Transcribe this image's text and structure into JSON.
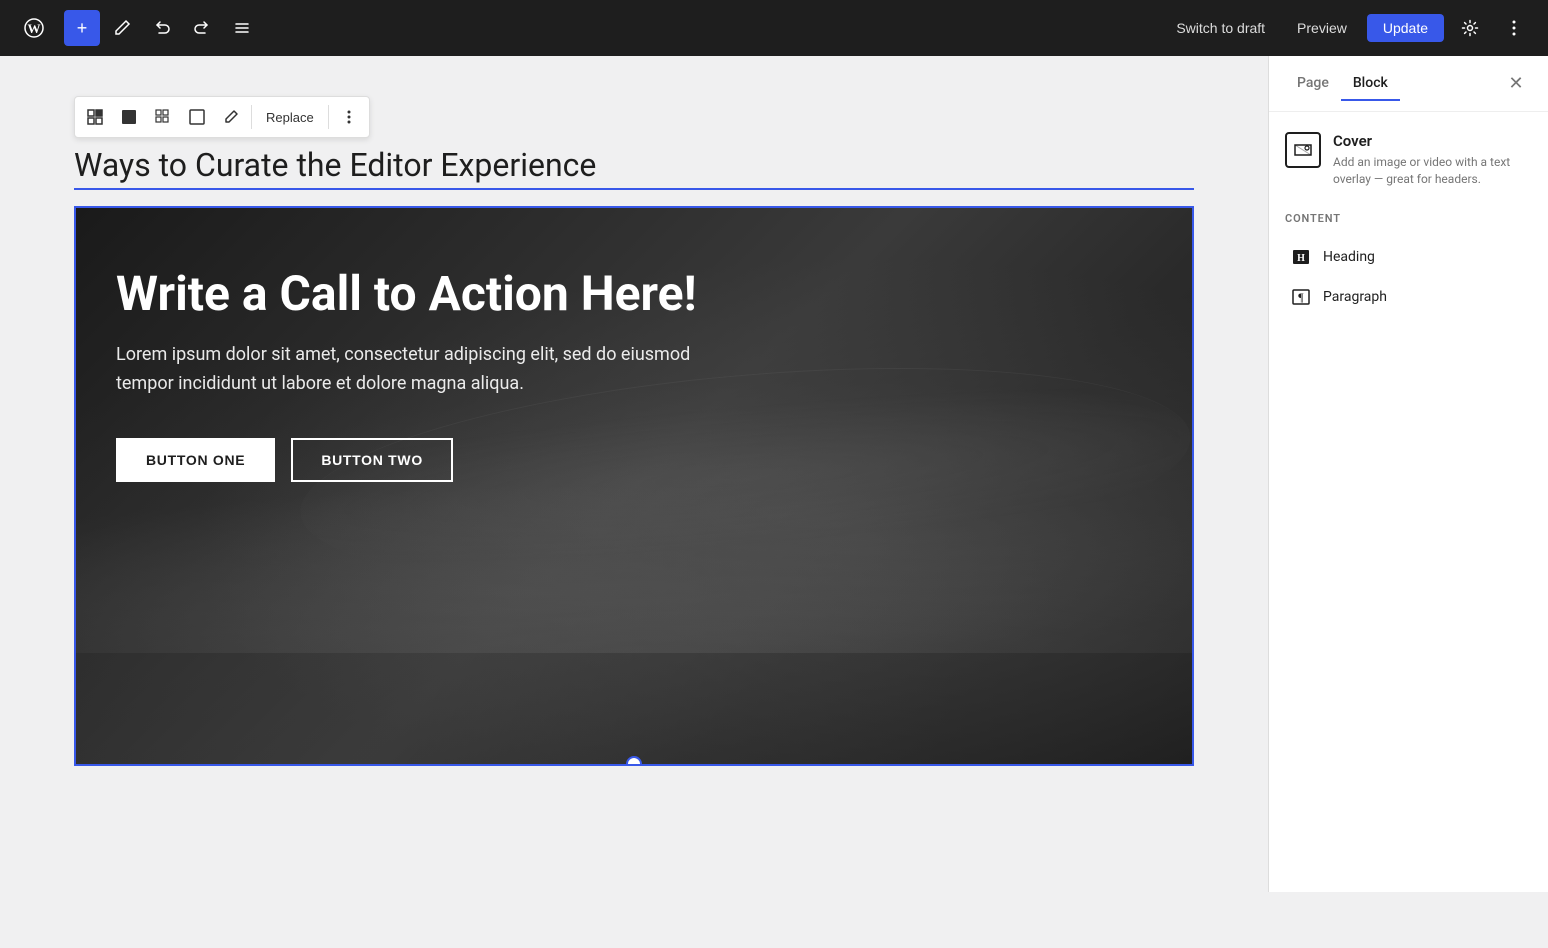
{
  "toolbar": {
    "add_label": "+",
    "undo_label": "↩",
    "redo_label": "↪",
    "list_view_label": "☰",
    "switch_to_draft_label": "Switch to draft",
    "preview_label": "Preview",
    "update_label": "Update"
  },
  "block_toolbar": {
    "icon_block": "▦",
    "icon_dark": "■",
    "icon_grid": "⠿",
    "icon_expand": "⛶",
    "icon_brush": "✎",
    "replace_label": "Replace",
    "more_label": "⋮"
  },
  "editor": {
    "page_title": "Ways to Curate the Editor Experience",
    "cover": {
      "heading": "Write a Call to Action Here!",
      "paragraph": "Lorem ipsum dolor sit amet, consectetur adipiscing elit, sed do eiusmod tempor incididunt ut labore et dolore magna aliqua.",
      "button_one_label": "BUTTON ONE",
      "button_two_label": "BUTTON TWO"
    }
  },
  "right_panel": {
    "tab_page_label": "Page",
    "tab_block_label": "Block",
    "close_label": "✕",
    "block_info": {
      "title": "Cover",
      "description": "Add an image or video with a text overlay — great for headers."
    },
    "content_section": {
      "title": "Content",
      "items": [
        {
          "icon": "H",
          "label": "Heading",
          "icon_type": "heading-icon"
        },
        {
          "icon": "¶",
          "label": "Paragraph",
          "icon_type": "paragraph-icon"
        }
      ]
    }
  }
}
